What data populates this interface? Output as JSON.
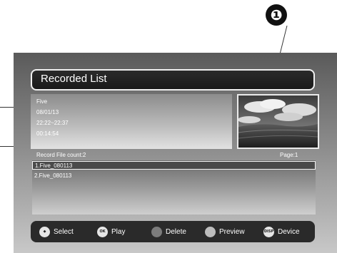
{
  "callout": {
    "number": "❶"
  },
  "title": "Recorded List",
  "info": {
    "name": "Five",
    "date": "08/01/13",
    "time_range": "22:22~22:37",
    "duration": "00:14:54"
  },
  "record_count": "Record File count:2",
  "page": "Page:1",
  "files": [
    {
      "label": "1.Five_080113",
      "selected": true
    },
    {
      "label": "2.Five_080113",
      "selected": false
    }
  ],
  "hints": [
    {
      "icon": "select-arrows-icon",
      "key": "◆",
      "label": "Select"
    },
    {
      "icon": "ok-button-icon",
      "key": "OK",
      "label": "Play"
    },
    {
      "icon": "grey-button-icon",
      "key": "",
      "label": "Delete"
    },
    {
      "icon": "light-grey-button-icon",
      "key": "",
      "label": "Preview"
    },
    {
      "icon": "disp-button-icon",
      "key": "DISP",
      "label": "Device"
    }
  ]
}
